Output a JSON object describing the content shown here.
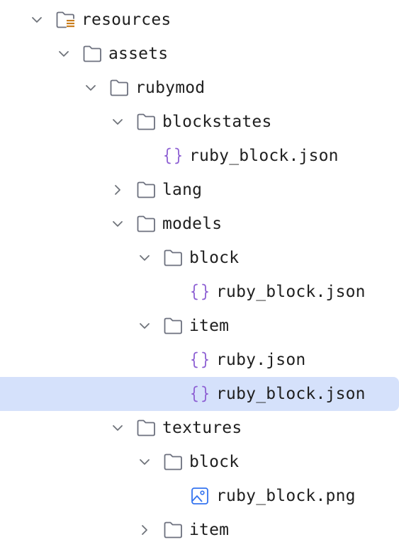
{
  "tree": [
    {
      "label": "resources",
      "type": "resources-folder",
      "depth": 0,
      "expanded": true
    },
    {
      "label": "assets",
      "type": "folder",
      "depth": 1,
      "expanded": true
    },
    {
      "label": "rubymod",
      "type": "folder",
      "depth": 2,
      "expanded": true
    },
    {
      "label": "blockstates",
      "type": "folder",
      "depth": 3,
      "expanded": true
    },
    {
      "label": "ruby_block.json",
      "type": "json",
      "depth": 4
    },
    {
      "label": "lang",
      "type": "folder",
      "depth": 3,
      "expanded": false
    },
    {
      "label": "models",
      "type": "folder",
      "depth": 3,
      "expanded": true
    },
    {
      "label": "block",
      "type": "folder",
      "depth": 4,
      "expanded": true
    },
    {
      "label": "ruby_block.json",
      "type": "json",
      "depth": 5
    },
    {
      "label": "item",
      "type": "folder",
      "depth": 4,
      "expanded": true
    },
    {
      "label": "ruby.json",
      "type": "json",
      "depth": 5
    },
    {
      "label": "ruby_block.json",
      "type": "json",
      "depth": 5,
      "selected": true
    },
    {
      "label": "textures",
      "type": "folder",
      "depth": 3,
      "expanded": true
    },
    {
      "label": "block",
      "type": "folder",
      "depth": 4,
      "expanded": true
    },
    {
      "label": "ruby_block.png",
      "type": "image",
      "depth": 5
    },
    {
      "label": "item",
      "type": "folder",
      "depth": 4,
      "expanded": false
    }
  ],
  "colors": {
    "selection": "#d5e1fb",
    "text": "#1f1f1f",
    "chevron": "#6f737a",
    "folder": "#6c707e",
    "resources_accent": "#c97d1c",
    "json_braces": "#8d5fd3",
    "image_icon": "#3574f0"
  }
}
